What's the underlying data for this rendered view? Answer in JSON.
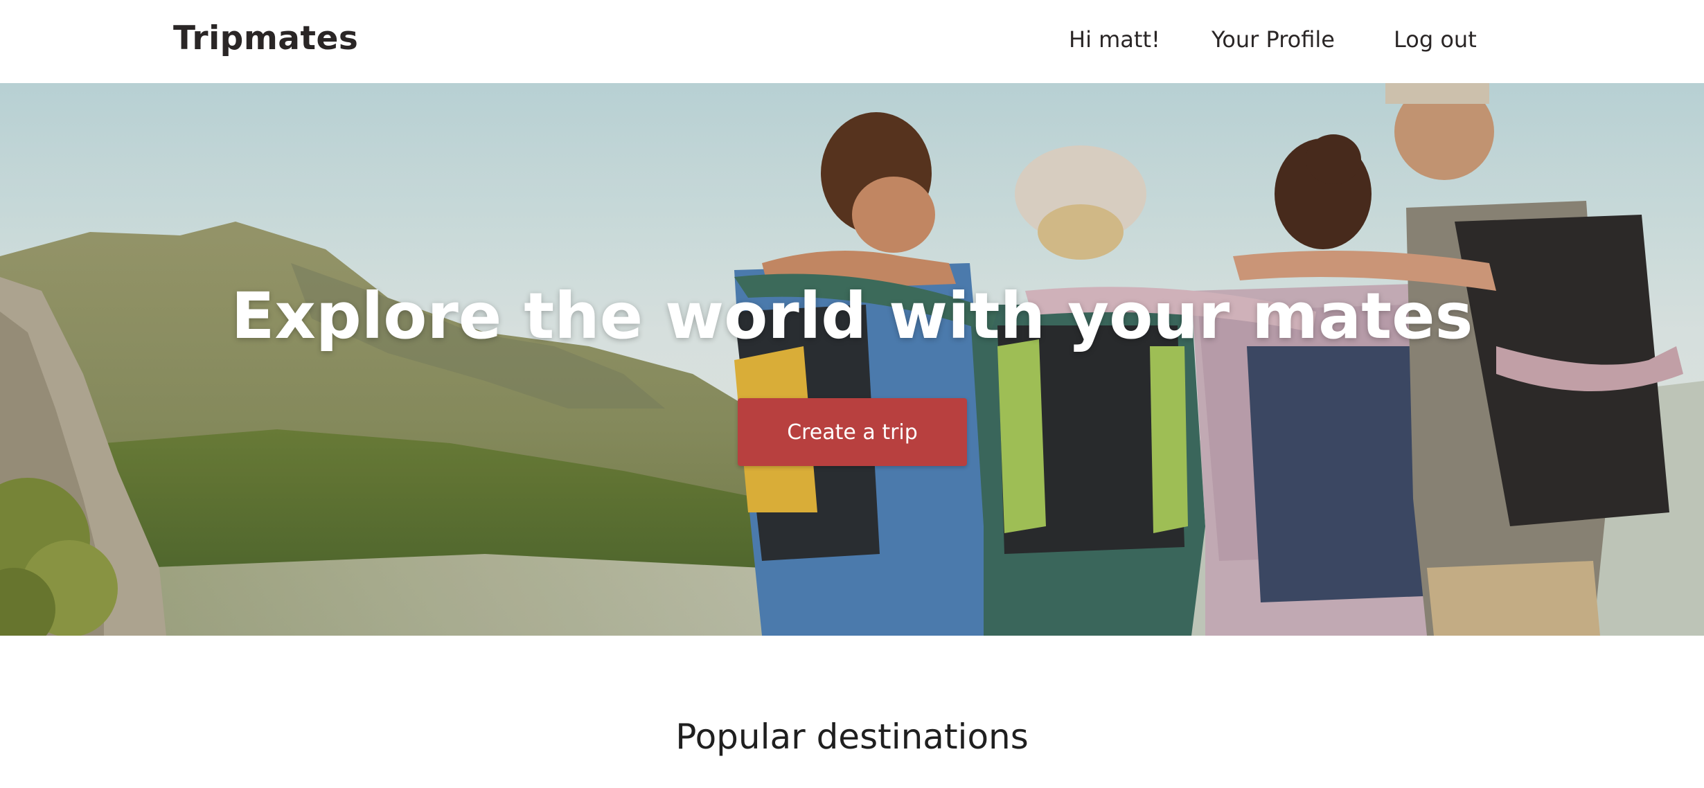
{
  "navbar": {
    "brand": "Tripmates",
    "greeting": "Hi matt!",
    "profile_link": "Your Profile",
    "logout_link": "Log out"
  },
  "hero": {
    "headline": "Explore the world with your mates",
    "cta_label": "Create a trip",
    "image_description": "group of four hikers with backpacks hugging and looking at mountains",
    "colors": {
      "cta_background": "#b8403f",
      "headline": "#ffffff"
    }
  },
  "popular": {
    "title": "Popular destinations"
  }
}
